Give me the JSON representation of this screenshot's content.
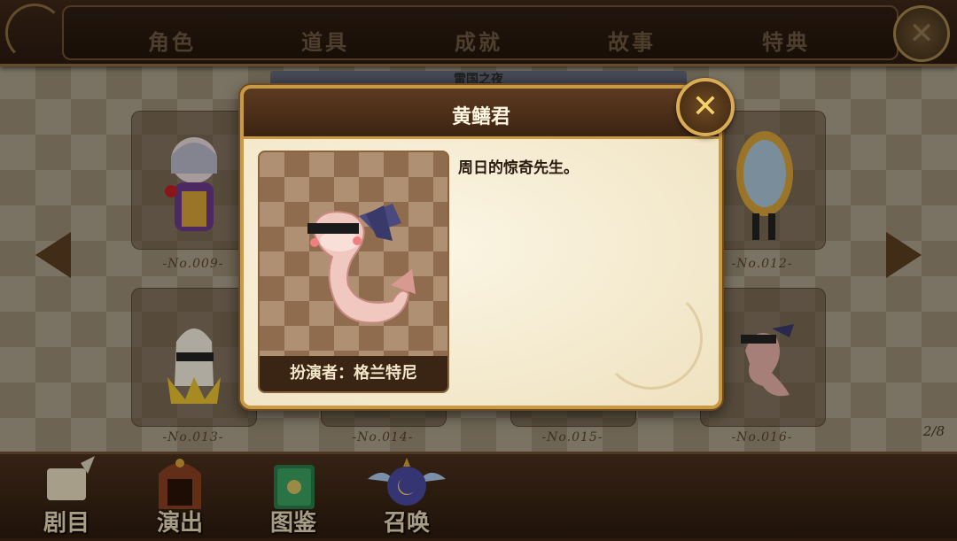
{
  "top_tabs": [
    "角色",
    "道具",
    "成就",
    "故事",
    "特典"
  ],
  "subtitle": "雷国之夜",
  "cards": [
    {
      "num": "-No.009-"
    },
    {
      "num": "-No.012-"
    },
    {
      "num": "-No.013-"
    },
    {
      "num": "-No.014-"
    },
    {
      "num": "-No.015-"
    },
    {
      "num": "-No.016-"
    }
  ],
  "page_indicator": "2/8",
  "bottom_nav": [
    "剧目",
    "演出",
    "图鉴",
    "召唤"
  ],
  "modal": {
    "title": "黄鳝君",
    "description": "周日的惊奇先生。",
    "actor": "扮演者：格兰特尼"
  },
  "close_glyph": "✕"
}
